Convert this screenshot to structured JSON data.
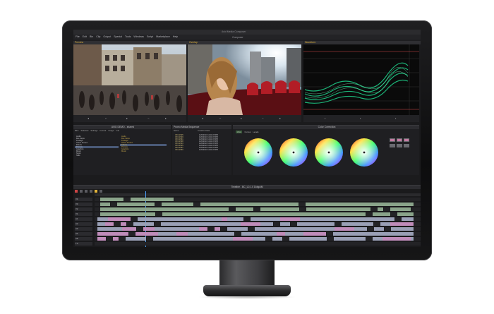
{
  "window": {
    "app_title": "Avid Media Composer",
    "project_name": "Composer"
  },
  "menu": [
    "File",
    "Edit",
    "Bin",
    "Clip",
    "Output",
    "Special",
    "Tools",
    "Windows",
    "Script",
    "Marketplace",
    "Help"
  ],
  "viewers": {
    "source_label": "Preview",
    "record_label": "Overlap",
    "scope_label": "Waveform"
  },
  "bin_panel": {
    "title": "AVID DEMO - shared",
    "tabs": [
      "Bins",
      "Selected",
      "Settings",
      "Format",
      "Usage",
      "Info"
    ],
    "items": [
      "Audio",
      "Bus Stops",
      "Footage",
      "Green Screen",
      "Effects",
      "Promos",
      "Graphics",
      "Music",
      "Stock",
      "Stills"
    ],
    "selected_index": 5
  },
  "clip_panel": {
    "title": "Promo Media Sequence",
    "columns": [
      "Name",
      "Creation Date"
    ],
    "rows": [
      {
        "name": "VFX-1525",
        "date": "1/20/2013 12:11:05 PM"
      },
      {
        "name": "VFX-1529",
        "date": "1/20/2013 12:11:05 PM"
      },
      {
        "name": "VFX-1531",
        "date": "1/20/2013 12:11:05 PM"
      },
      {
        "name": "VFX-1538",
        "date": "1/20/2013 12:11:05 PM"
      },
      {
        "name": "VFX-1543",
        "date": "1/20/2013 12:11:05 PM"
      },
      {
        "name": "VFX-1545",
        "date": "1/20/2013 12:11:05 PM"
      },
      {
        "name": "VFX-1551",
        "date": "1/20/2013 12:11:05 PM"
      },
      {
        "name": "VFX-1560",
        "date": "1/20/2013 12:11:05 PM"
      }
    ]
  },
  "color_panel": {
    "title": "Color Correction",
    "mode_tabs": [
      "HSL",
      "Curves",
      "Levels"
    ],
    "wheel_labels": [
      "Master",
      "Shadows",
      "Midtones",
      "Highlights"
    ]
  },
  "timeline": {
    "title": "Timeline - BC_L0.1.0 DotgulM",
    "tracks": [
      "V4",
      "V3",
      "V2",
      "V1",
      "A1",
      "A2",
      "A3",
      "A4",
      "A5",
      "TC"
    ]
  },
  "colors": {
    "accent": "#e0b23a",
    "video_clip": "#8aa48a",
    "audio_clip": "#9aa0b6",
    "playhead": "#4aa0ff"
  }
}
